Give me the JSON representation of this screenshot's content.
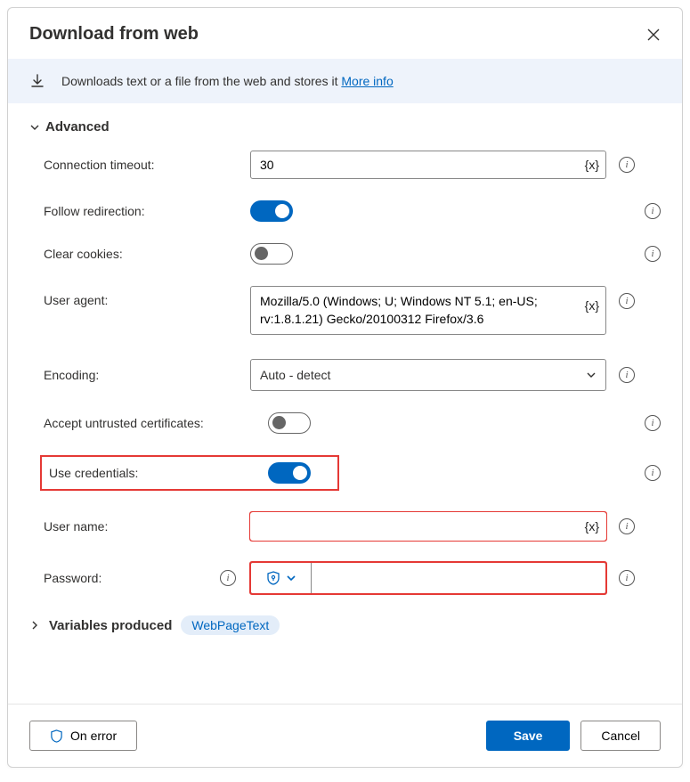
{
  "dialog": {
    "title": "Download from web",
    "banner_text": "Downloads text or a file from the web and stores it ",
    "banner_link": "More info"
  },
  "sections": {
    "advanced": {
      "label": "Advanced",
      "fields": {
        "connection_timeout": {
          "label": "Connection timeout:",
          "value": "30"
        },
        "follow_redirection": {
          "label": "Follow redirection:",
          "on": true
        },
        "clear_cookies": {
          "label": "Clear cookies:",
          "on": false
        },
        "user_agent": {
          "label": "User agent:",
          "value": "Mozilla/5.0 (Windows; U; Windows NT 5.1; en-US; rv:1.8.1.21) Gecko/20100312 Firefox/3.6"
        },
        "encoding": {
          "label": "Encoding:",
          "value": "Auto - detect"
        },
        "accept_untrusted": {
          "label": "Accept untrusted certificates:",
          "on": false
        },
        "use_credentials": {
          "label": "Use credentials:",
          "on": true
        },
        "user_name": {
          "label": "User name:",
          "value": ""
        },
        "password": {
          "label": "Password:",
          "value": ""
        }
      }
    },
    "variables_produced": {
      "label": "Variables produced",
      "chip": "WebPageText"
    }
  },
  "footer": {
    "on_error": "On error",
    "save": "Save",
    "cancel": "Cancel"
  },
  "glyphs": {
    "var_insert": "{x}"
  }
}
